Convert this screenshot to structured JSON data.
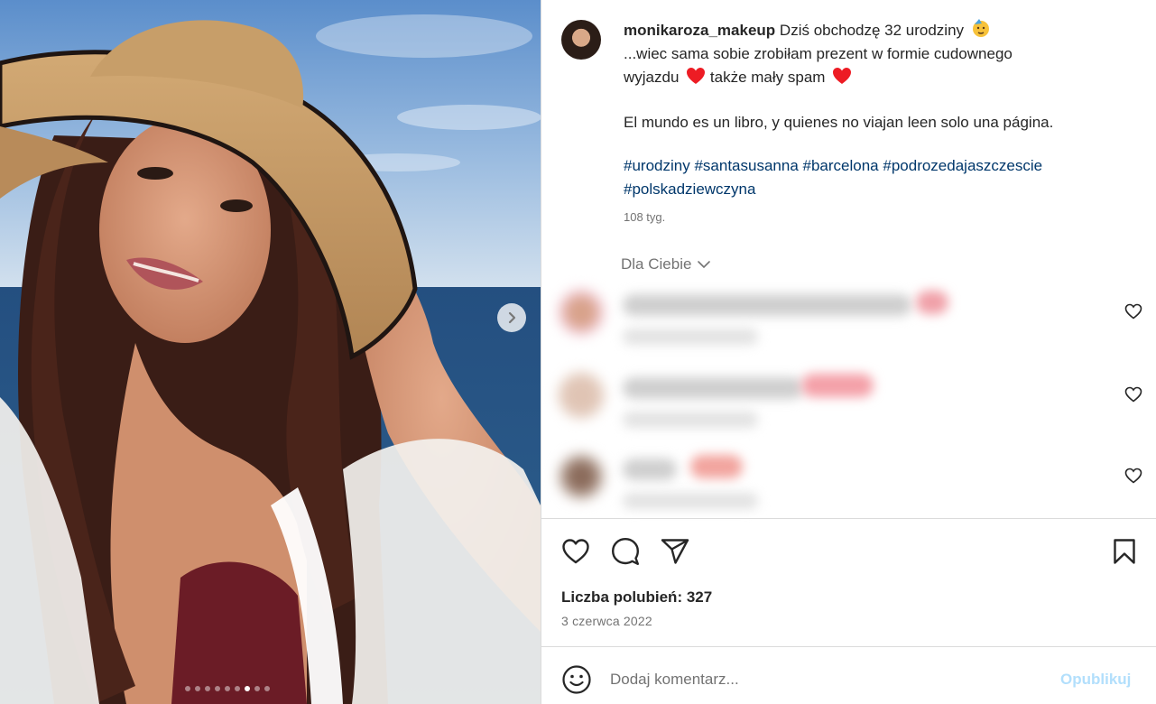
{
  "post": {
    "username": "monikaroza_makeup",
    "caption_line1": "Dziś obchodzę 32 urodziny",
    "caption_line1_emoji": "birthday-face-emoji",
    "caption_line2": "...wiec sama sobie zrobiłam prezent w formie cudownego",
    "caption_line3a": "wyjazdu",
    "caption_line3b": "także mały spam",
    "quote": "El mundo es un libro, y quienes no viajan leen solo una página.",
    "hashtags": [
      "#urodziny",
      "#santasusanna",
      "#barcelona",
      "#podrozedajaszczescie",
      "#polskadziewczyna"
    ],
    "time_ago": "108 tyg."
  },
  "comments_section": {
    "filter_label": "Dla Ciebie",
    "comments": [
      {
        "text": "",
        "blurred": true
      },
      {
        "text": "",
        "blurred": true
      },
      {
        "text": "",
        "blurred": true
      }
    ]
  },
  "stats": {
    "likes": "Liczba polubień: 327",
    "date": "3 czerwca 2022"
  },
  "composer": {
    "placeholder": "Dodaj komentarz...",
    "publish_label": "Opublikuj"
  },
  "carousel": {
    "total_slides": 9,
    "current_slide": 7
  },
  "colors": {
    "text": "#262626",
    "muted": "#737373",
    "hashtag": "#00376b",
    "publish_disabled": "#b2dffc",
    "heart_red": "#ed1c24"
  },
  "icons": {
    "like": "heart-icon",
    "comment": "comment-bubble-icon",
    "share": "paper-plane-icon",
    "save": "bookmark-icon",
    "emoji": "smiley-icon",
    "next": "chevron-right-icon"
  }
}
